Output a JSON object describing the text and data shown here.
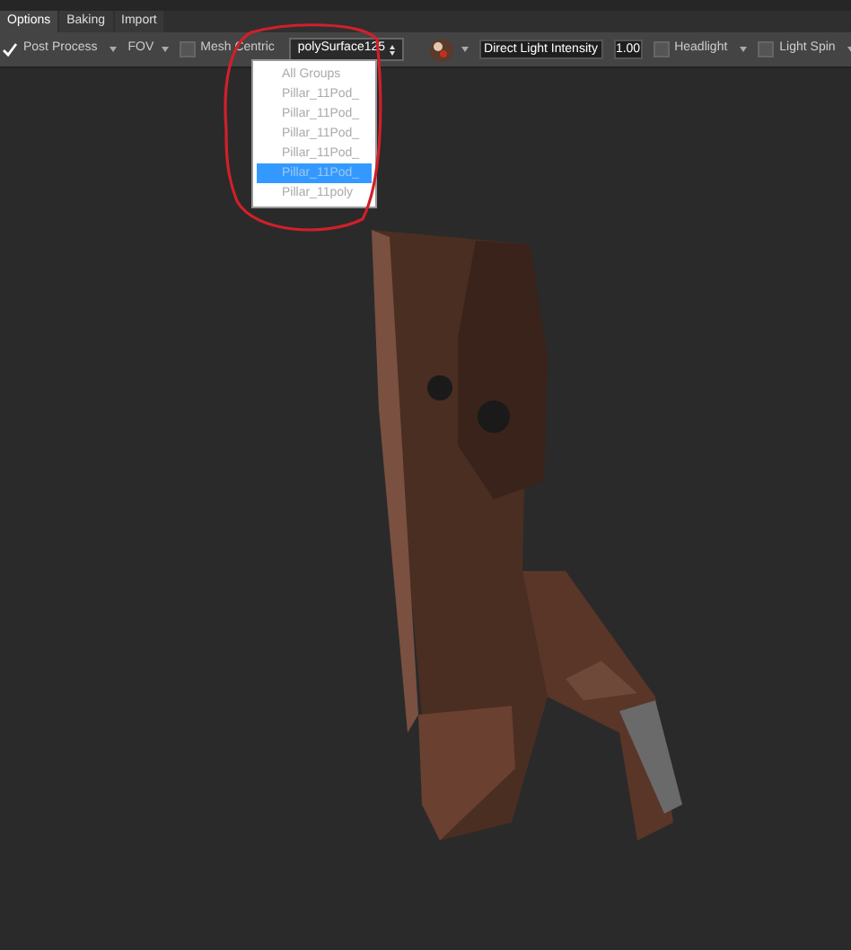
{
  "tabs": [
    {
      "label": "Options",
      "selected": true
    },
    {
      "label": "Baking",
      "selected": false
    },
    {
      "label": "Import",
      "selected": false
    }
  ],
  "toolbar": {
    "post_process": {
      "label": "Post Process",
      "checked": true
    },
    "fov": {
      "label": "FOV"
    },
    "mesh_centric": {
      "label": "Mesh Centric",
      "checked": false
    },
    "group_select": {
      "value": "polySurface125"
    },
    "light_field": {
      "value": "Direct Light Intensity"
    },
    "light_value": {
      "value": "1.00"
    },
    "headlight": {
      "label": "Headlight",
      "checked": false
    },
    "light_spin": {
      "label": "Light Spin",
      "checked": false
    }
  },
  "group_menu": {
    "items": [
      {
        "label": "All Groups",
        "selected": false
      },
      {
        "label": "Pillar_11Pod_",
        "selected": false
      },
      {
        "label": "Pillar_11Pod_",
        "selected": false
      },
      {
        "label": "Pillar_11Pod_",
        "selected": false
      },
      {
        "label": "Pillar_11Pod_",
        "selected": false
      },
      {
        "label": "Pillar_11Pod_",
        "selected": true
      },
      {
        "label": "Pillar_11poly",
        "selected": false
      }
    ]
  }
}
